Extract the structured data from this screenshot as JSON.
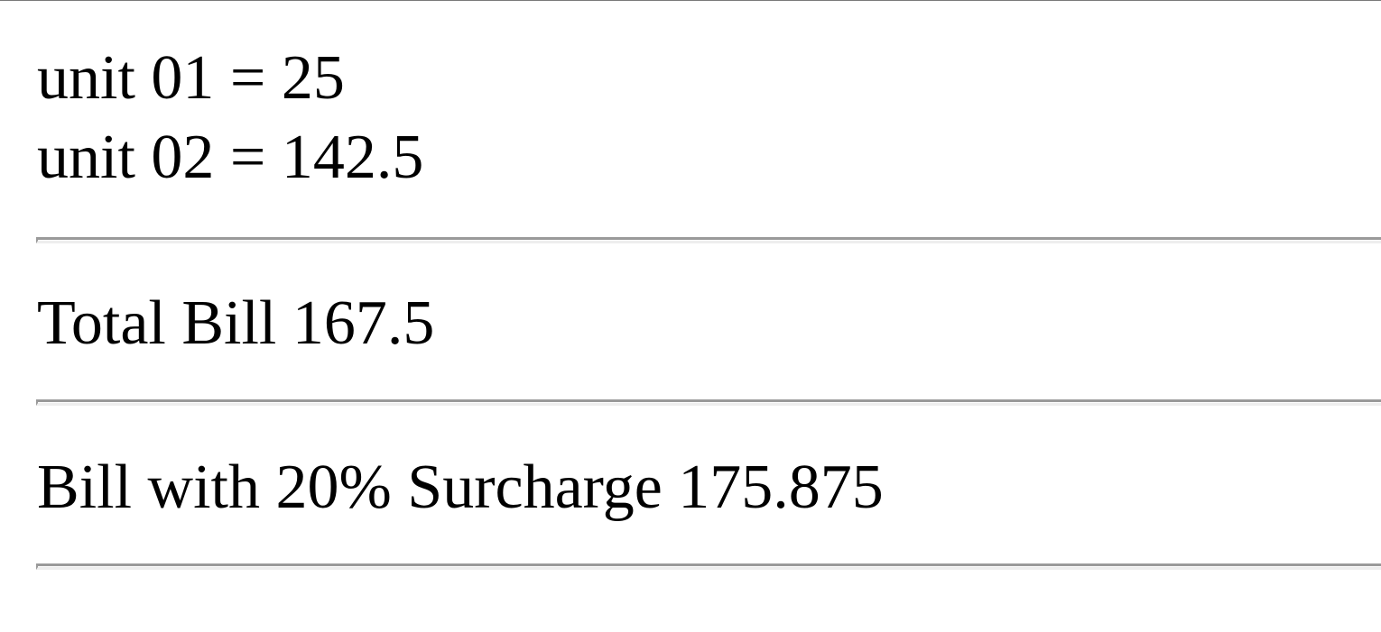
{
  "lines": {
    "unit01": "unit 01 = 25",
    "unit02": "unit 02 = 142.5",
    "total": "Total Bill 167.5",
    "surcharge": "Bill with 20% Surcharge 175.875"
  }
}
